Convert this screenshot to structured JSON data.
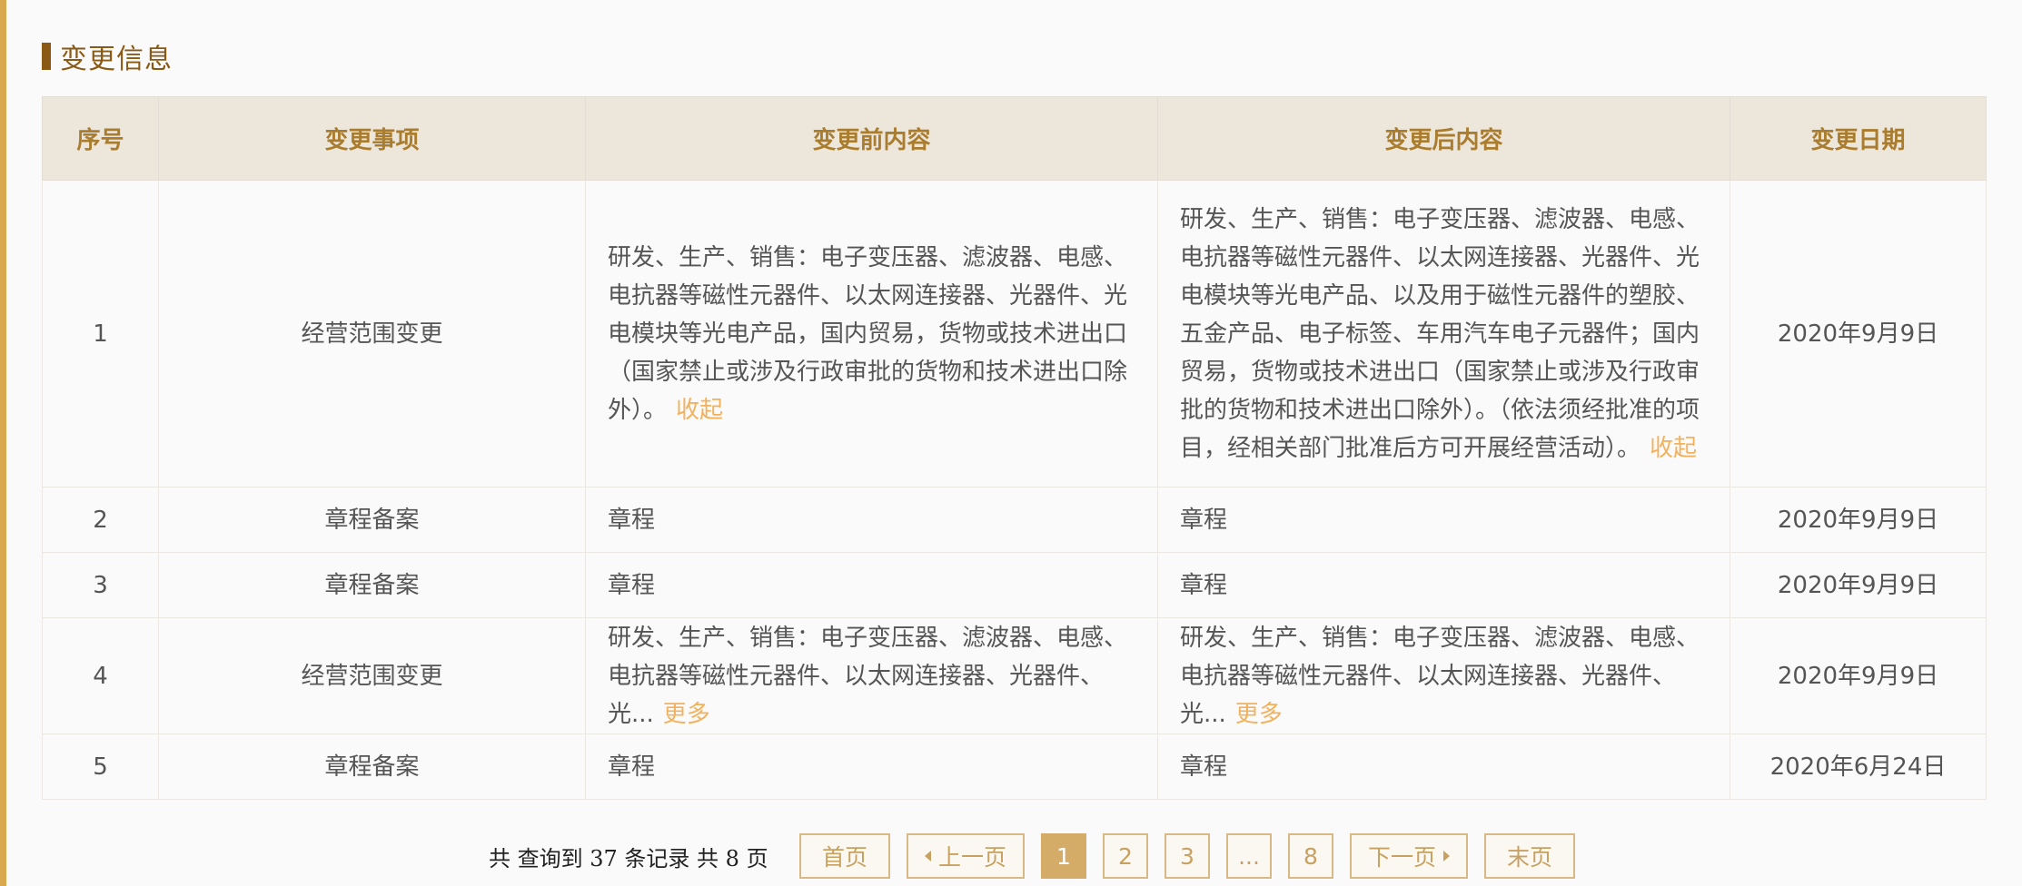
{
  "section": {
    "title": "变更信息"
  },
  "colors": {
    "accent": "#d8a94f",
    "title": "#8a5a15",
    "header_bg": "#ede6db",
    "link": "#f3b15c"
  },
  "table": {
    "headers": [
      "序号",
      "变更事项",
      "变更前内容",
      "变更后内容",
      "变更日期"
    ],
    "rows": [
      {
        "no": "1",
        "item": "经营范围变更",
        "before": "研发、生产、销售：电子变压器、滤波器、电感、电抗器等磁性元器件、以太网连接器、光器件、光电模块等光电产品，国内贸易，货物或技术进出口（国家禁止或涉及行政审批的货物和技术进出口除外）。",
        "before_link": "收起",
        "after": "研发、生产、销售：电子变压器、滤波器、电感、电抗器等磁性元器件、以太网连接器、光器件、光电模块等光电产品、以及用于磁性元器件的塑胶、五金产品、电子标签、车用汽车电子元器件；国内贸易，货物或技术进出口（国家禁止或涉及行政审批的货物和技术进出口除外）。（依法须经批准的项目，经相关部门批准后方可开展经营活动）。",
        "after_link": "收起",
        "date": "2020年9月9日"
      },
      {
        "no": "2",
        "item": "章程备案",
        "before": "章程",
        "after": "章程",
        "date": "2020年9月9日"
      },
      {
        "no": "3",
        "item": "章程备案",
        "before": "章程",
        "after": "章程",
        "date": "2020年9月9日"
      },
      {
        "no": "4",
        "item": "经营范围变更",
        "before": "研发、生产、销售：电子变压器、滤波器、电感、电抗器等磁性元器件、以太网连接器、光器件、光...",
        "before_link": "更多",
        "after": "研发、生产、销售：电子变压器、滤波器、电感、电抗器等磁性元器件、以太网连接器、光器件、光...",
        "after_link": "更多",
        "date": "2020年9月9日"
      },
      {
        "no": "5",
        "item": "章程备案",
        "before": "章程",
        "after": "章程",
        "date": "2020年6月24日"
      }
    ]
  },
  "pagination": {
    "summary": "共 查询到 37 条记录 共 8 页",
    "first": "首页",
    "prev": "上一页",
    "pages": [
      "1",
      "2",
      "3",
      "...",
      "8"
    ],
    "current": "1",
    "next": "下一页",
    "last": "末页",
    "prev_icon": "caret-left-icon",
    "next_icon": "caret-right-icon"
  }
}
